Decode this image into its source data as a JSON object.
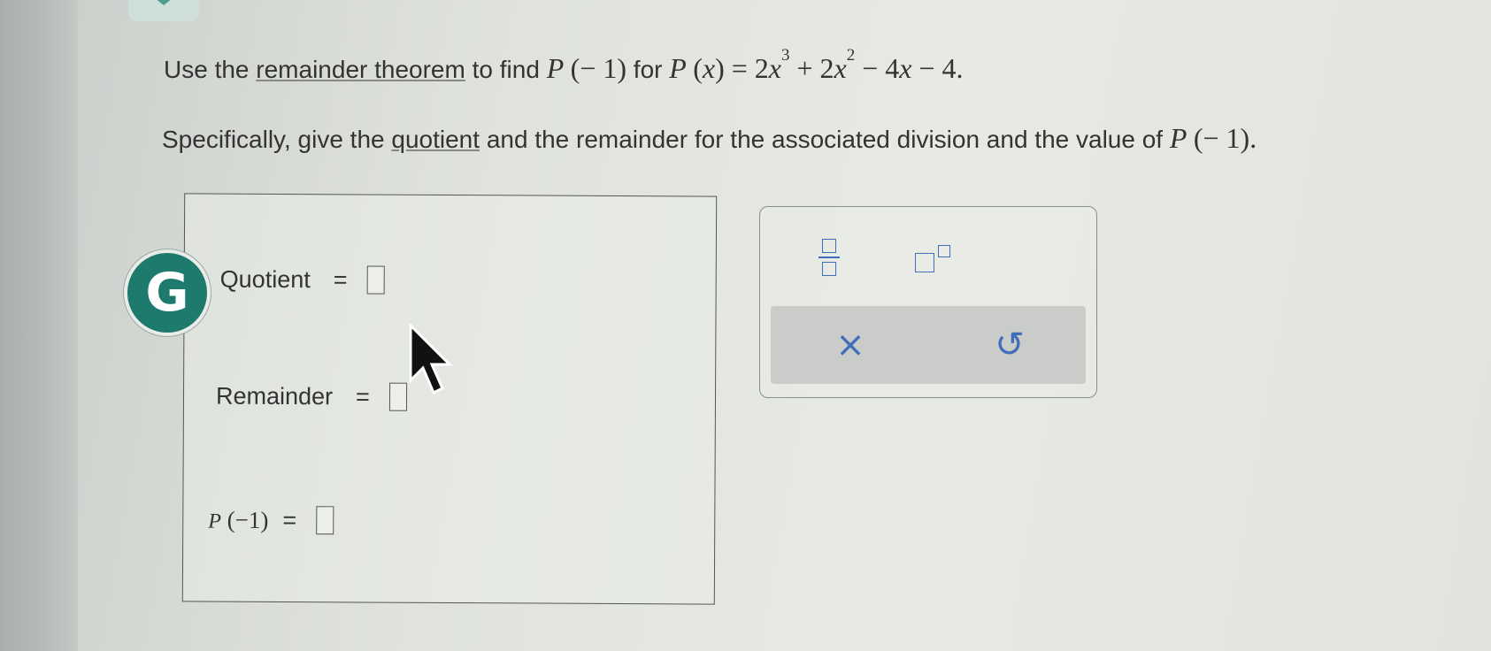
{
  "question": {
    "line1_prefix": "Use the",
    "line1_link": "remainder theorem",
    "line1_mid": "to find",
    "line1_for": "for",
    "line2_prefix": "Specifically, give the",
    "line2_link": "quotient",
    "line2_suffix": "and the remainder for the associated division and the value of"
  },
  "answer": {
    "quotient_label": "Quotient",
    "remainder_label": "Remainder",
    "equals": "=",
    "quotient_value": "",
    "remainder_value": "",
    "p_value": ""
  },
  "badge": {
    "letter": "G",
    "color": "#1e7a6c"
  },
  "toolbox": {
    "clear_symbol": "×",
    "undo_symbol": "↺",
    "accent": "#3e6fb8"
  },
  "icons": [
    "fraction-icon",
    "superscript-icon",
    "clear-icon",
    "undo-icon",
    "cursor-arrow-icon"
  ]
}
